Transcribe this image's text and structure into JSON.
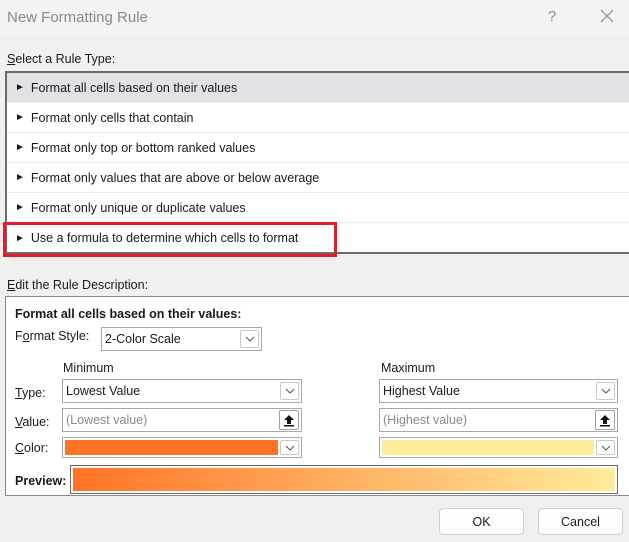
{
  "window": {
    "title": "New Formatting Rule",
    "help_label": "?",
    "close_icon": "close-icon"
  },
  "rule_type": {
    "label_accel": "S",
    "label_rest": "elect a Rule Type:",
    "items": [
      {
        "label": "Format all cells based on their values",
        "selected": true
      },
      {
        "label": "Format only cells that contain",
        "selected": false
      },
      {
        "label": "Format only top or bottom ranked values",
        "selected": false
      },
      {
        "label": "Format only values that are above or below average",
        "selected": false
      },
      {
        "label": "Format only unique or duplicate values",
        "selected": false
      },
      {
        "label": "Use a formula to determine which cells to format",
        "selected": false,
        "highlighted": true
      }
    ],
    "bullet_glyph": "►"
  },
  "description": {
    "label_accel": "E",
    "label_rest": "dit the Rule Description:",
    "heading": "Format all cells based on their values:",
    "format_style": {
      "label_pre": "F",
      "label_accel": "o",
      "label_post": "rmat Style:",
      "value": "2-Color Scale"
    },
    "minimum": {
      "header": "Minimum",
      "type": "Lowest Value",
      "value_placeholder": "(Lowest value)",
      "color": "#ff7326"
    },
    "maximum": {
      "header": "Maximum",
      "type": "Highest Value",
      "value_placeholder": "(Highest value)",
      "color": "#ffeb9c"
    },
    "row_labels": {
      "type_accel": "T",
      "type_rest": "ype:",
      "value_accel": "V",
      "value_rest": "alue:",
      "color_accel": "C",
      "color_rest": "olor:"
    },
    "preview_label": "Preview:"
  },
  "buttons": {
    "ok": "OK",
    "cancel": "Cancel"
  },
  "colors": {
    "highlight_box": "#e8192c",
    "selected_row": "#e1e1e6"
  }
}
